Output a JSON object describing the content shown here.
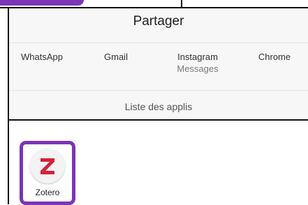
{
  "share": {
    "title": "Partager",
    "targets": [
      {
        "label": "WhatsApp",
        "sub": ""
      },
      {
        "label": "Gmail",
        "sub": ""
      },
      {
        "label": "Instagram",
        "sub": "Messages"
      },
      {
        "label": "Chrome",
        "sub": ""
      }
    ],
    "all_apps_label": "Liste des applis"
  },
  "app": {
    "label": "Zotero",
    "icon": "zotero-z-icon",
    "icon_color": "#d6223a"
  },
  "colors": {
    "highlight": "#7b35b5",
    "sheet_bg": "#f7f7f7"
  }
}
